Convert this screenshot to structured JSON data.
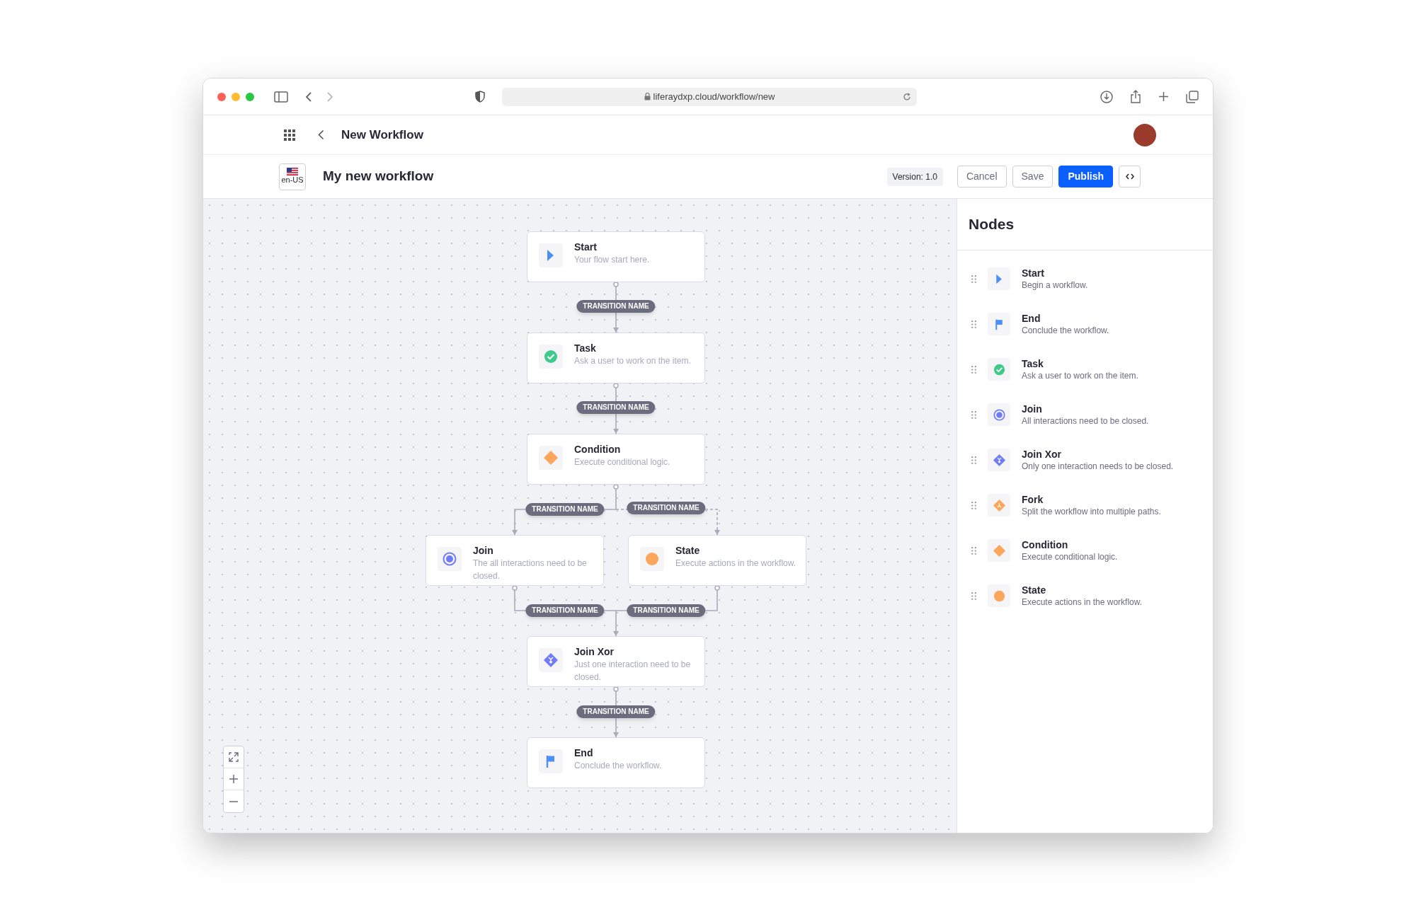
{
  "browser": {
    "url": "liferaydxp.cloud/workflow/new"
  },
  "header": {
    "title": "New Workflow"
  },
  "toolbar": {
    "locale": "en-US",
    "workflow_name": "My new workflow",
    "version": "Version: 1.0",
    "buttons": [
      {
        "label": "Cancel",
        "kind": "secondary"
      },
      {
        "label": "Save",
        "kind": "secondary"
      },
      {
        "label": "Publish",
        "kind": "primary"
      }
    ]
  },
  "canvas": {
    "nodes": [
      {
        "kind": "start",
        "title": "Start",
        "description": "Your flow start here."
      },
      {
        "kind": "task",
        "title": "Task",
        "description": "Ask a user to work on the item."
      },
      {
        "kind": "condition",
        "title": "Condition",
        "description": "Execute conditional logic."
      },
      {
        "kind": "join",
        "title": "Join",
        "description": "The all interactions need to be closed."
      },
      {
        "kind": "state",
        "title": "State",
        "description": "Execute actions in the workflow."
      },
      {
        "kind": "join_xor",
        "title": "Join Xor",
        "description": "Just one interaction need to be closed."
      },
      {
        "kind": "end",
        "title": "End",
        "description": "Conclude the workflow."
      }
    ],
    "transitions": [
      {
        "label": "TRANSITION NAME",
        "dashed": false
      },
      {
        "label": "TRANSITION NAME",
        "dashed": false
      },
      {
        "label": "TRANSITION NAME",
        "dashed": false
      },
      {
        "label": "TRANSITION NAME",
        "dashed": true
      },
      {
        "label": "TRANSITION NAME",
        "dashed": false
      },
      {
        "label": "TRANSITION NAME",
        "dashed": false
      },
      {
        "label": "TRANSITION NAME",
        "dashed": false
      }
    ]
  },
  "sidebar": {
    "title": "Nodes",
    "items": [
      {
        "kind": "start",
        "title": "Start",
        "description": "Begin a workflow."
      },
      {
        "kind": "end",
        "title": "End",
        "description": "Conclude the workflow."
      },
      {
        "kind": "task",
        "title": "Task",
        "description": "Ask a user to work on the item."
      },
      {
        "kind": "join",
        "title": "Join",
        "description": "All interactions need to be closed."
      },
      {
        "kind": "join_xor",
        "title": "Join Xor",
        "description": "Only one interaction needs to be closed."
      },
      {
        "kind": "fork",
        "title": "Fork",
        "description": "Split the workflow into multiple paths."
      },
      {
        "kind": "condition",
        "title": "Condition",
        "description": "Execute conditional logic."
      },
      {
        "kind": "state",
        "title": "State",
        "description": "Execute actions in the workflow."
      }
    ]
  }
}
